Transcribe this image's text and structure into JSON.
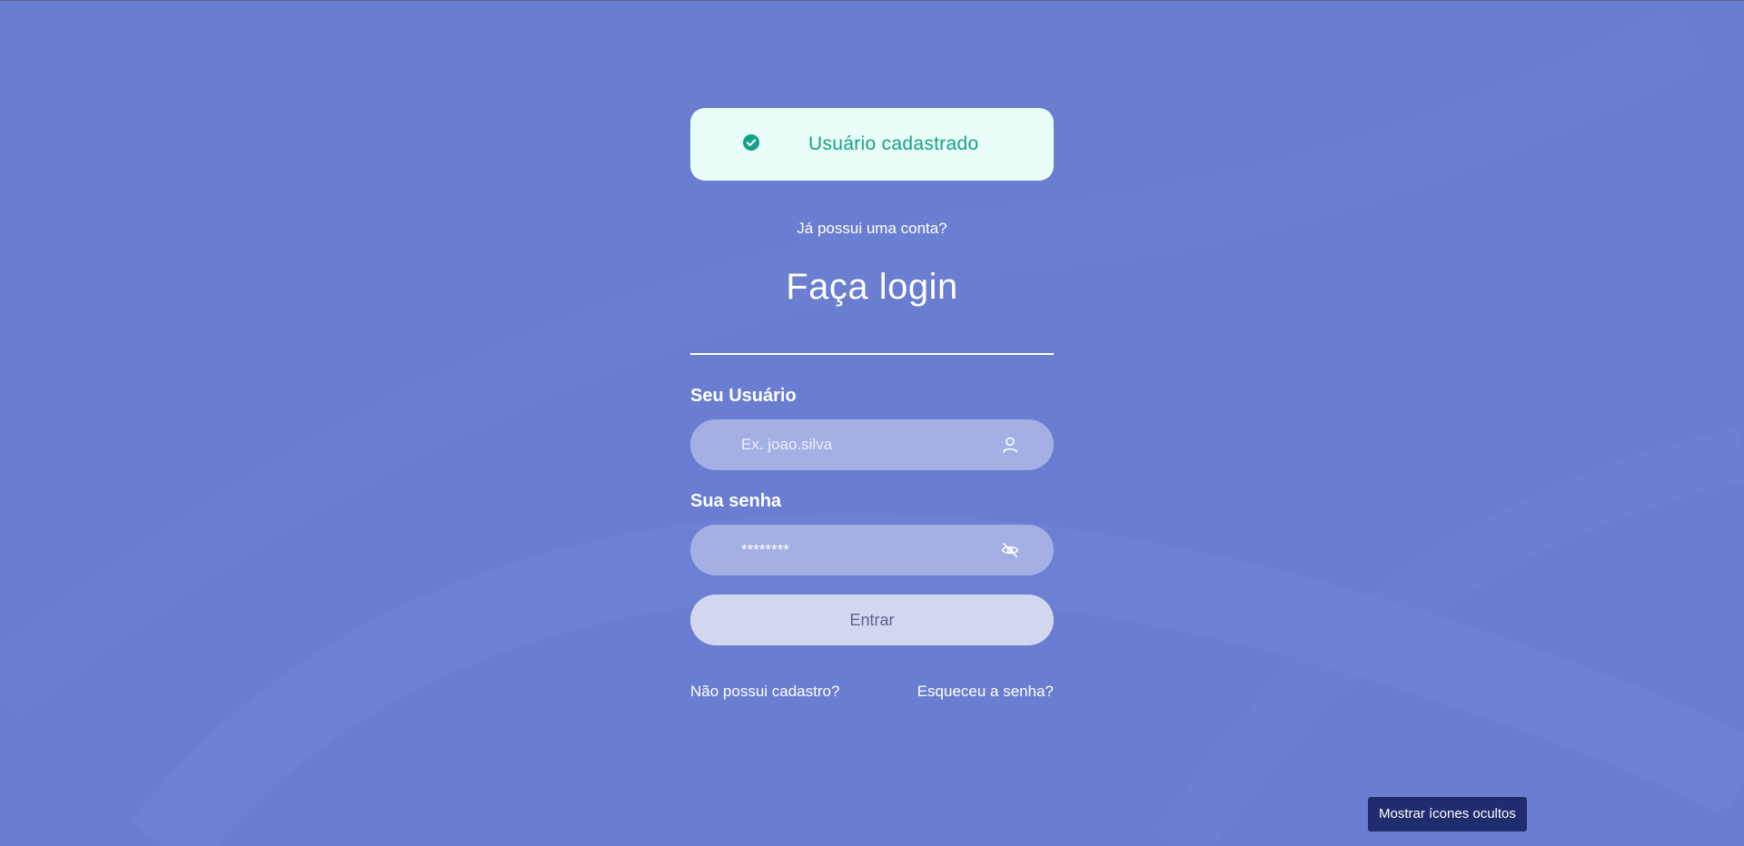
{
  "toast": {
    "message": "Usuário cadastrado",
    "icon": "check-circle-icon",
    "color": "#16a085",
    "background": "#eafef9"
  },
  "login": {
    "prompt": "Já possui uma conta?",
    "title": "Faça login",
    "username_label": "Seu Usuário",
    "username_placeholder": "Ex. joao.silva",
    "username_icon": "user-icon",
    "password_label": "Sua senha",
    "password_value": "********",
    "password_icon": "eye-off-icon",
    "submit_label": "Entrar",
    "register_link": "Não possui cadastro?",
    "forgot_link": "Esqueceu a senha?"
  },
  "system": {
    "tooltip": "Mostrar ícones ocultos"
  },
  "colors": {
    "background": "#6a7dd1",
    "field": "#a4afe3",
    "button": "#d3d8f1",
    "tooltip": "#1f2d6e"
  }
}
